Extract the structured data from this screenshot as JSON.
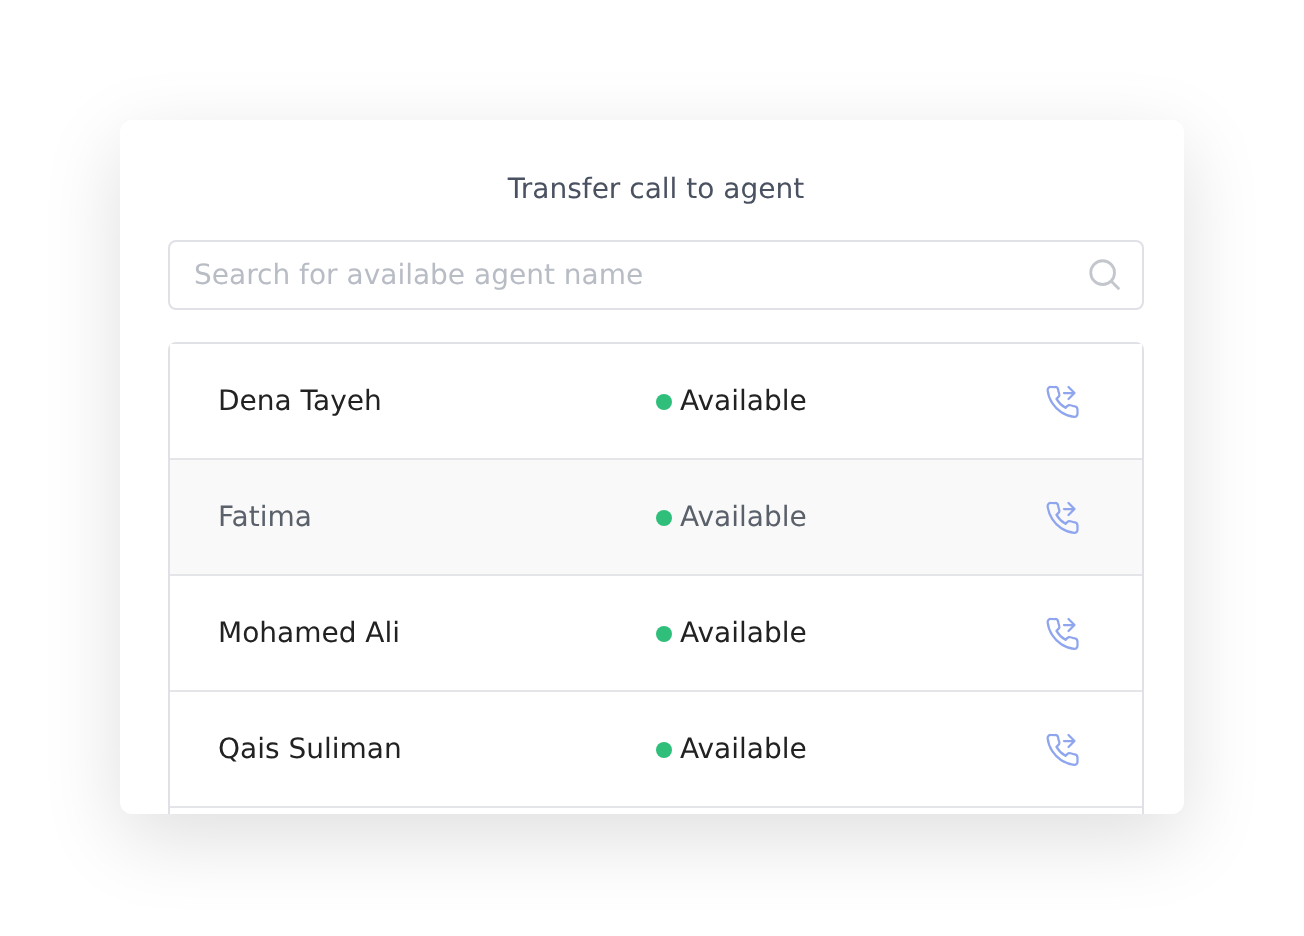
{
  "dialog": {
    "title": "Transfer call to agent"
  },
  "search": {
    "placeholder": "Search for availabe agent name"
  },
  "agents": [
    {
      "name": "Dena Tayeh",
      "status": "Available",
      "color": "#2fbf7a",
      "selected": false
    },
    {
      "name": "Fatima",
      "status": "Available",
      "color": "#2fbf7a",
      "selected": true
    },
    {
      "name": "Mohamed Ali",
      "status": "Available",
      "color": "#2fbf7a",
      "selected": false
    },
    {
      "name": "Qais Suliman",
      "status": "Available",
      "color": "#2fbf7a",
      "selected": false
    }
  ]
}
